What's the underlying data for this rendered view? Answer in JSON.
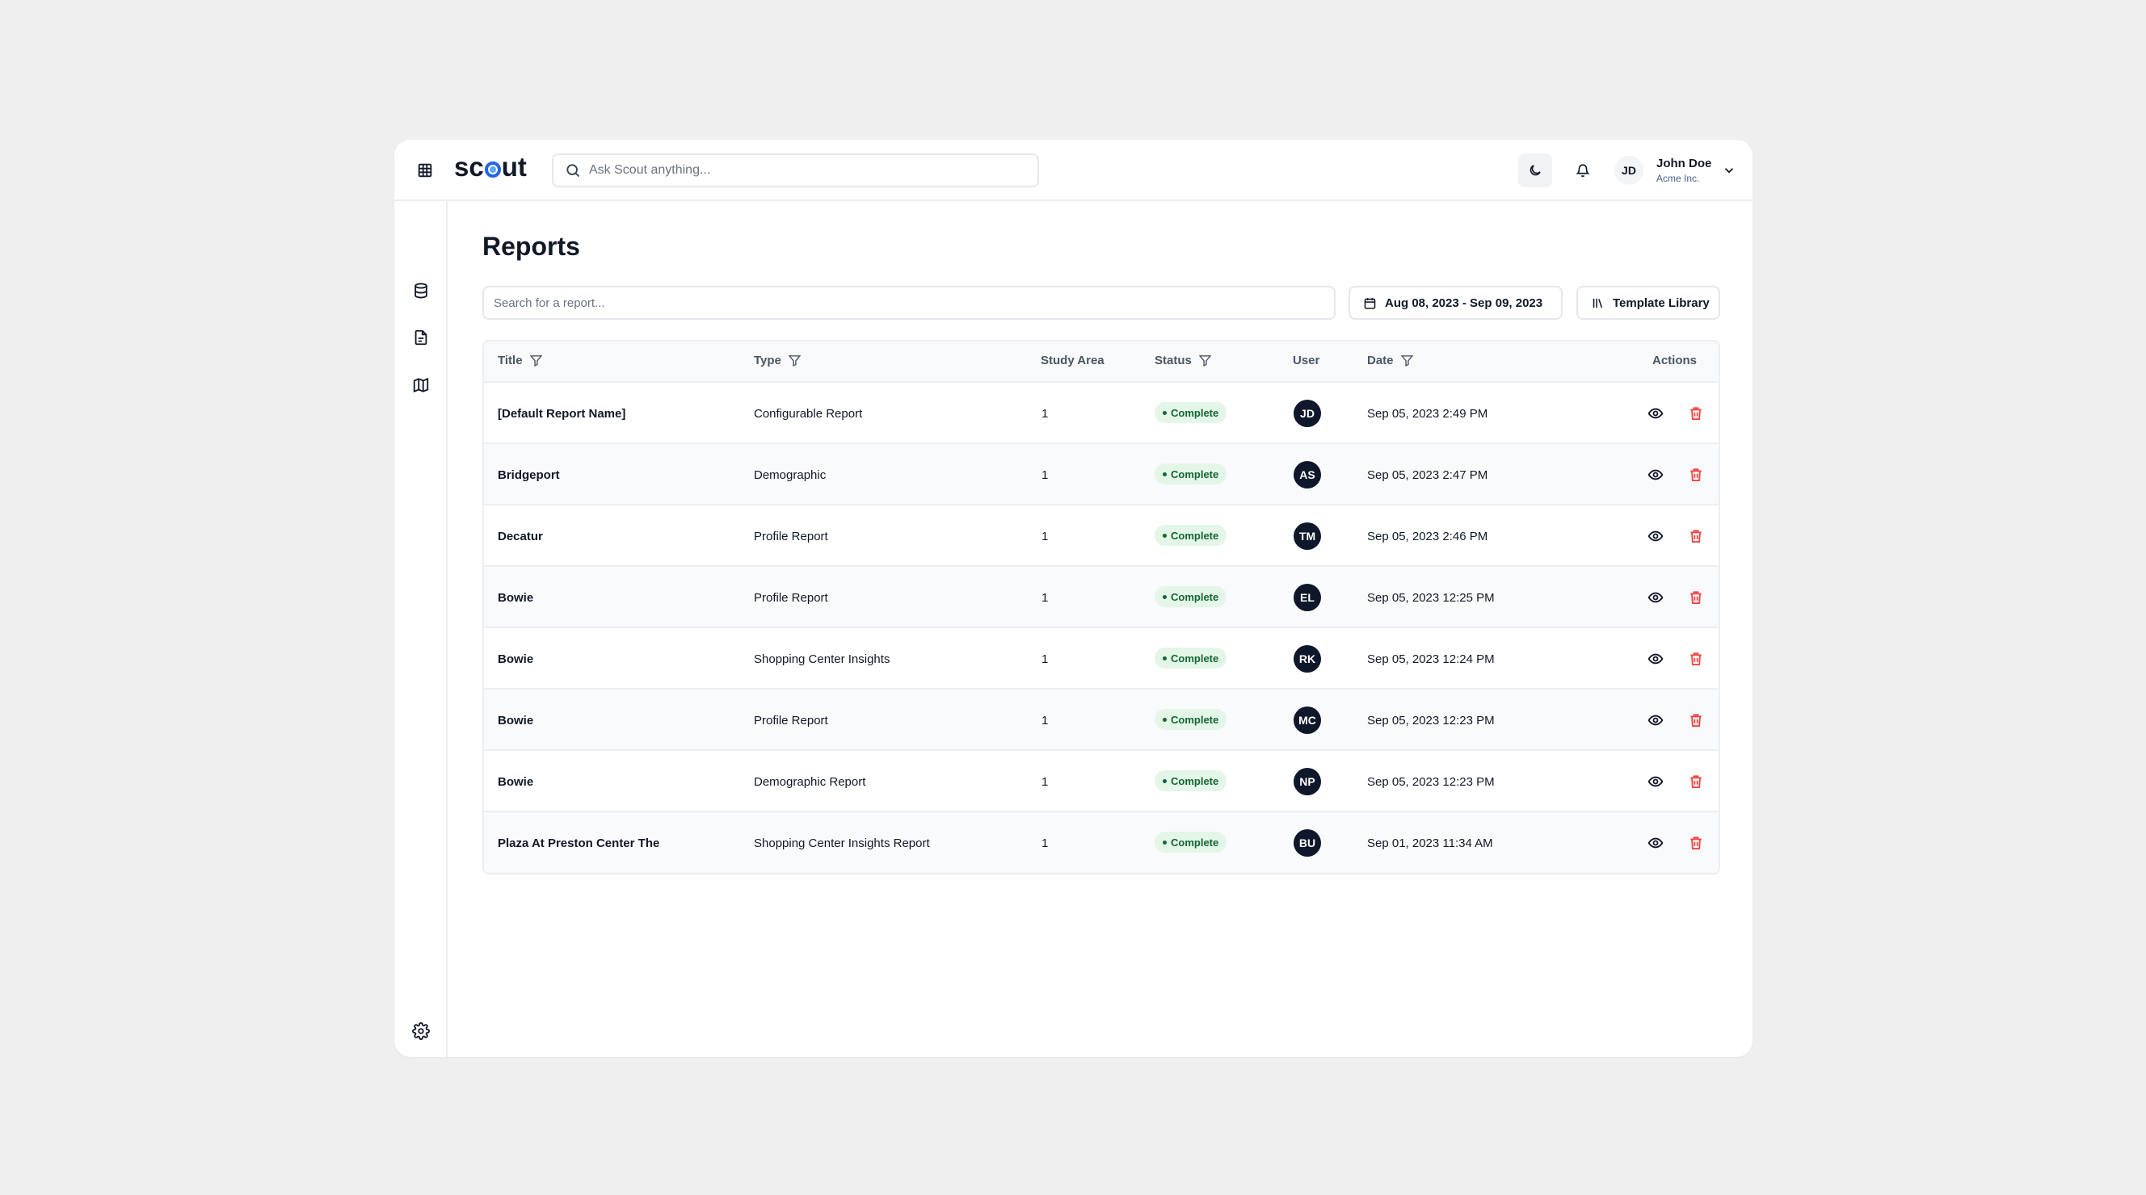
{
  "header": {
    "logo": {
      "pre": "sc",
      "post": "ut"
    },
    "search_placeholder": "Ask Scout anything...",
    "user": {
      "initials": "JD",
      "name": "John Doe",
      "org": "Acme Inc."
    }
  },
  "page": {
    "title": "Reports",
    "search_placeholder": "Search for a report...",
    "date_range": "Aug 08, 2023 - Sep 09, 2023",
    "template_library": "Template Library"
  },
  "table": {
    "columns": {
      "title": "Title",
      "type": "Type",
      "study_area": "Study Area",
      "status": "Status",
      "user": "User",
      "date": "Date",
      "actions": "Actions"
    },
    "rows": [
      {
        "title": "[Default Report Name]",
        "type": "Configurable Report",
        "study_area": "1",
        "status": "Complete",
        "user": "JD",
        "date": "Sep 05, 2023 2:49 PM"
      },
      {
        "title": "Bridgeport",
        "type": "Demographic",
        "study_area": "1",
        "status": "Complete",
        "user": "AS",
        "date": "Sep 05, 2023 2:47 PM"
      },
      {
        "title": "Decatur",
        "type": "Profile Report",
        "study_area": "1",
        "status": "Complete",
        "user": "TM",
        "date": "Sep 05, 2023 2:46 PM"
      },
      {
        "title": "Bowie",
        "type": "Profile Report",
        "study_area": "1",
        "status": "Complete",
        "user": "EL",
        "date": "Sep 05, 2023 12:25 PM"
      },
      {
        "title": "Bowie",
        "type": "Shopping Center Insights",
        "study_area": "1",
        "status": "Complete",
        "user": "RK",
        "date": "Sep 05, 2023 12:24 PM"
      },
      {
        "title": "Bowie",
        "type": "Profile Report",
        "study_area": "1",
        "status": "Complete",
        "user": "MC",
        "date": "Sep 05, 2023 12:23 PM"
      },
      {
        "title": "Bowie",
        "type": "Demographic Report",
        "study_area": "1",
        "status": "Complete",
        "user": "NP",
        "date": "Sep 05, 2023 12:23 PM"
      },
      {
        "title": "Plaza At Preston Center The",
        "type": "Shopping Center Insights Report",
        "study_area": "1",
        "status": "Complete",
        "user": "BU",
        "date": "Sep 01, 2023 11:34 AM"
      }
    ]
  },
  "colors": {
    "brand": "#2563eb",
    "status_complete_bg": "#e3f6e8",
    "status_complete_text": "#166534",
    "delete": "#ef4444",
    "avatar_bg": "#0f172a"
  },
  "icons": {
    "apps": "grid-icon",
    "search": "search-icon",
    "theme": "moon-icon",
    "notifications": "bell-icon",
    "user_menu": "chevron-down-icon",
    "sidebar": [
      "database-icon",
      "file-icon",
      "map-icon"
    ],
    "settings": "gear-icon",
    "calendar": "calendar-icon",
    "library": "library-icon",
    "filter": "filter-icon",
    "view": "eye-icon",
    "delete": "trash-icon"
  }
}
